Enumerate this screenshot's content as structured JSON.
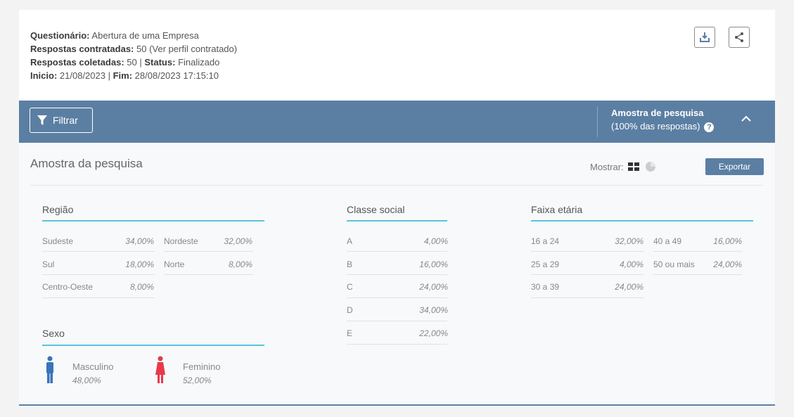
{
  "info": {
    "questionario_label": "Questionário:",
    "questionario_value": "Abertura de uma Empresa",
    "contratadas_label": "Respostas contratadas:",
    "contratadas_value": "50 (Ver perfil contratado)",
    "coletadas_label": "Respostas coletadas:",
    "coletadas_value": "50 |",
    "status_label": "Status:",
    "status_value": "Finalizado",
    "inicio_label": "Inicio:",
    "inicio_value": "21/08/2023 |",
    "fim_label": "Fim:",
    "fim_value": "28/08/2023 17:15:10"
  },
  "bar": {
    "filter_label": "Filtrar",
    "sample_title": "Amostra de pesquisa",
    "sample_subtitle": "(100% das respostas)",
    "help": "?"
  },
  "panel": {
    "title": "Amostra da pesquisa",
    "show_label": "Mostrar:",
    "export_label": "Exportar"
  },
  "regiao": {
    "title": "Região",
    "left": [
      {
        "label": "Sudeste",
        "value": "34,00%"
      },
      {
        "label": "Sul",
        "value": "18,00%"
      },
      {
        "label": "Centro-Oeste",
        "value": "8,00%"
      }
    ],
    "right": [
      {
        "label": "Nordeste",
        "value": "32,00%"
      },
      {
        "label": "Norte",
        "value": "8,00%"
      }
    ]
  },
  "sexo": {
    "title": "Sexo",
    "male_label": "Masculino",
    "male_value": "48,00%",
    "female_label": "Feminino",
    "female_value": "52,00%",
    "male_color": "#3a74b8",
    "female_color": "#e8394a"
  },
  "classe": {
    "title": "Classe social",
    "rows": [
      {
        "label": "A",
        "value": "4,00%"
      },
      {
        "label": "B",
        "value": "16,00%"
      },
      {
        "label": "C",
        "value": "24,00%"
      },
      {
        "label": "D",
        "value": "34,00%"
      },
      {
        "label": "E",
        "value": "22,00%"
      }
    ]
  },
  "faixa": {
    "title": "Faixa etária",
    "left": [
      {
        "label": "16 a 24",
        "value": "32,00%"
      },
      {
        "label": "25 a 29",
        "value": "4,00%"
      },
      {
        "label": "30 a 39",
        "value": "24,00%"
      }
    ],
    "right": [
      {
        "label": "40 a 49",
        "value": "16,00%"
      },
      {
        "label": "50 ou mais",
        "value": "24,00%"
      }
    ]
  },
  "colors": {
    "accent": "#5b7fa3",
    "section_underline": "#57c4dd"
  }
}
